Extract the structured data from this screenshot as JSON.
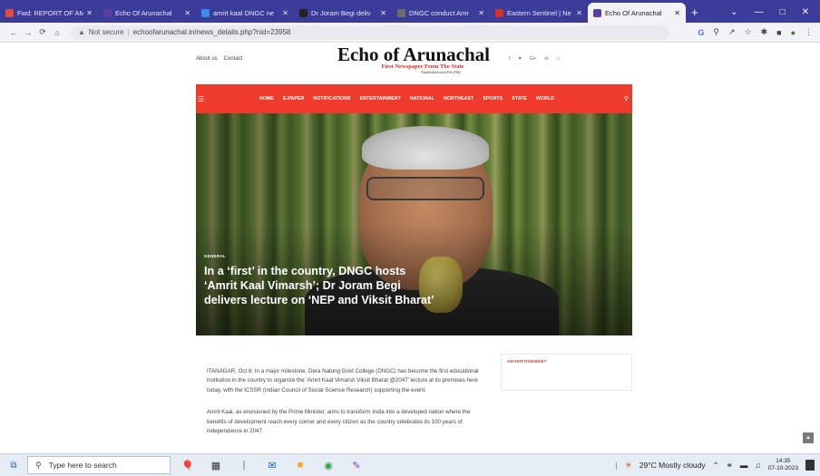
{
  "browser": {
    "tabs": [
      {
        "title": "Fwd: REPORT OF AM",
        "favicon_color": "#e34a3a",
        "active": false
      },
      {
        "title": "Echo Of Arunachal",
        "favicon_color": "#5b3fa0",
        "active": false
      },
      {
        "title": "amrit kaal DNGC ne",
        "favicon_color": "#3b8ee8",
        "active": false
      },
      {
        "title": "Dr Joram Begi deliv",
        "favicon_color": "#222222",
        "active": false
      },
      {
        "title": "DNGC conduct Amr",
        "favicon_color": "#6c6c6c",
        "active": false
      },
      {
        "title": "Eastern Sentinel | Ne",
        "favicon_color": "#d93025",
        "active": false
      },
      {
        "title": "Echo Of Arunachal",
        "favicon_color": "#5b3fa0",
        "active": true
      }
    ],
    "new_tab": "+",
    "security_label": "Not secure",
    "url": "echoofarunachal.in/news_details.php?nid=23958"
  },
  "site": {
    "top_links": [
      "About us",
      "Contact"
    ],
    "logo_title": "Echo of Arunachal",
    "logo_tagline": "First Newspaper From The State",
    "logo_established": "Established sixth Feb 2002",
    "social_icons": [
      "facebook-icon",
      "twitter-icon",
      "google-plus-icon",
      "linkedin-icon",
      "instagram-icon"
    ],
    "social_glyphs": [
      "f",
      "♥",
      "G+",
      "in",
      "□"
    ],
    "menu": [
      "HOME",
      "E-PAPER",
      "NOTIFICATIONS",
      "ENTERTAINMENT",
      "NATIONAL",
      "NORTHEAST",
      "SPORTS",
      "STATE",
      "WORLD"
    ]
  },
  "article": {
    "category": "GENERAL",
    "headline": "In a ‘first’ in the country, DNGC hosts ‘Amrit Kaal Vimarsh’; Dr Joram Begi delivers lecture on ‘NEP and Viksit Bharat’",
    "paragraphs": [
      "ITANAGAR, Oct 6: In a major milestone, Dera Natung Govt College (DNGC) has become the first educational institution in the country to organize the ‘Amrit Kaal Vimarsh Viksit Bharat @2047’ lecture at its premises here today, with the ICSSR (Indian Council of Social Science Research) supporting the event.",
      "Amrit Kaal, as envisioned by the Prime Minister, aims to transform India into a developed nation where the benefits of development reach every corner and every citizen as the country celebrates its 100 years of independence in 2047."
    ]
  },
  "sidebar": {
    "advertisement_label": "ADVERTISEMENT"
  },
  "taskbar": {
    "search_placeholder": "Type here to search",
    "weather": "29°C  Mostly cloudy",
    "time": "14:35",
    "date": "07-10-2023"
  }
}
